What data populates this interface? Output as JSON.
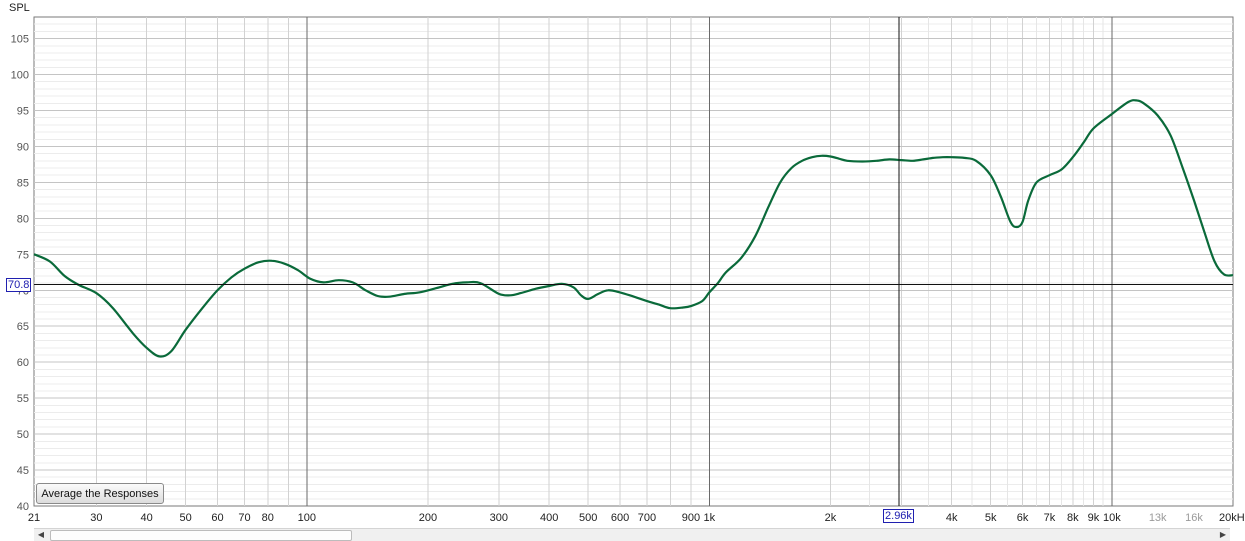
{
  "button": {
    "average_label": "Average the Responses"
  },
  "cursor": {
    "level_label": "70.8",
    "freq_label": "2.96k"
  },
  "chart_data": {
    "type": "line",
    "title": "",
    "ylabel": "SPL",
    "xlabel": "",
    "x_scale": "log",
    "xlim": [
      21,
      20000
    ],
    "ylim": [
      40,
      108
    ],
    "grid": true,
    "y_ticks": [
      105,
      100,
      95,
      90,
      85,
      80,
      75,
      70,
      65,
      60,
      55,
      50,
      45,
      40
    ],
    "x_ticks": [
      {
        "value": 21,
        "label": "21"
      },
      {
        "value": 30,
        "label": "30"
      },
      {
        "value": 40,
        "label": "40"
      },
      {
        "value": 50,
        "label": "50"
      },
      {
        "value": 60,
        "label": "60"
      },
      {
        "value": 70,
        "label": "70"
      },
      {
        "value": 80,
        "label": "80"
      },
      {
        "value": 100,
        "label": "100"
      },
      {
        "value": 200,
        "label": "200"
      },
      {
        "value": 300,
        "label": "300"
      },
      {
        "value": 400,
        "label": "400"
      },
      {
        "value": 500,
        "label": "500"
      },
      {
        "value": 600,
        "label": "600"
      },
      {
        "value": 700,
        "label": "700"
      },
      {
        "value": 900,
        "label": "900"
      },
      {
        "value": 1000,
        "label": "1k"
      },
      {
        "value": 2000,
        "label": "2k"
      },
      {
        "value": 4000,
        "label": "4k"
      },
      {
        "value": 5000,
        "label": "5k"
      },
      {
        "value": 6000,
        "label": "6k"
      },
      {
        "value": 7000,
        "label": "7k"
      },
      {
        "value": 8000,
        "label": "8k"
      },
      {
        "value": 9000,
        "label": "9k"
      },
      {
        "value": 10000,
        "label": "10k"
      },
      {
        "value": 13000,
        "label": "13k",
        "faint": true
      },
      {
        "value": 16000,
        "label": "16k",
        "faint": true
      },
      {
        "value": 20000,
        "label": "20kHz"
      }
    ],
    "cursor": {
      "x": 2960,
      "y": 70.8
    },
    "line_color": "#0a6a3a",
    "series": [
      {
        "name": "",
        "x": [
          21,
          23,
          25,
          27,
          30,
          33,
          37,
          40,
          43,
          46,
          50,
          55,
          60,
          65,
          70,
          76,
          82,
          88,
          95,
          102,
          110,
          120,
          130,
          140,
          150,
          160,
          175,
          190,
          210,
          230,
          250,
          270,
          300,
          320,
          340,
          370,
          400,
          430,
          460,
          480,
          500,
          530,
          560,
          600,
          650,
          700,
          750,
          800,
          860,
          900,
          960,
          1000,
          1050,
          1100,
          1200,
          1300,
          1400,
          1500,
          1600,
          1700,
          1800,
          1900,
          2000,
          2100,
          2200,
          2400,
          2600,
          2800,
          3000,
          3200,
          3400,
          3600,
          3800,
          4000,
          4300,
          4600,
          5000,
          5300,
          5600,
          5800,
          6000,
          6200,
          6500,
          7000,
          7500,
          8000,
          8500,
          9000,
          10000,
          11000,
          11500,
          12000,
          13000,
          14000,
          15000,
          16000,
          17000,
          18000,
          19000,
          20000
        ],
        "y": [
          75.0,
          74.0,
          72.0,
          70.8,
          69.6,
          67.5,
          64.0,
          62.0,
          60.8,
          61.5,
          64.5,
          67.5,
          70.0,
          71.8,
          73.0,
          73.9,
          74.1,
          73.7,
          72.8,
          71.6,
          71.1,
          71.4,
          71.1,
          70.0,
          69.2,
          69.1,
          69.5,
          69.7,
          70.3,
          70.9,
          71.1,
          71.0,
          69.5,
          69.3,
          69.6,
          70.2,
          70.6,
          70.9,
          70.4,
          69.3,
          68.8,
          69.5,
          70.0,
          69.7,
          69.1,
          68.5,
          68.0,
          67.5,
          67.6,
          67.8,
          68.5,
          69.7,
          71.0,
          72.5,
          74.5,
          77.5,
          81.5,
          85.0,
          87.0,
          88.0,
          88.5,
          88.7,
          88.6,
          88.3,
          88.0,
          87.9,
          88.0,
          88.2,
          88.1,
          88.0,
          88.2,
          88.4,
          88.5,
          88.5,
          88.4,
          88.0,
          86.0,
          83.0,
          79.5,
          78.8,
          79.5,
          82.5,
          85.0,
          86.0,
          86.8,
          88.5,
          90.5,
          92.5,
          94.5,
          96.2,
          96.4,
          96.0,
          94.3,
          91.5,
          87.0,
          82.5,
          78.0,
          74.0,
          72.2,
          72.1
        ]
      }
    ]
  }
}
